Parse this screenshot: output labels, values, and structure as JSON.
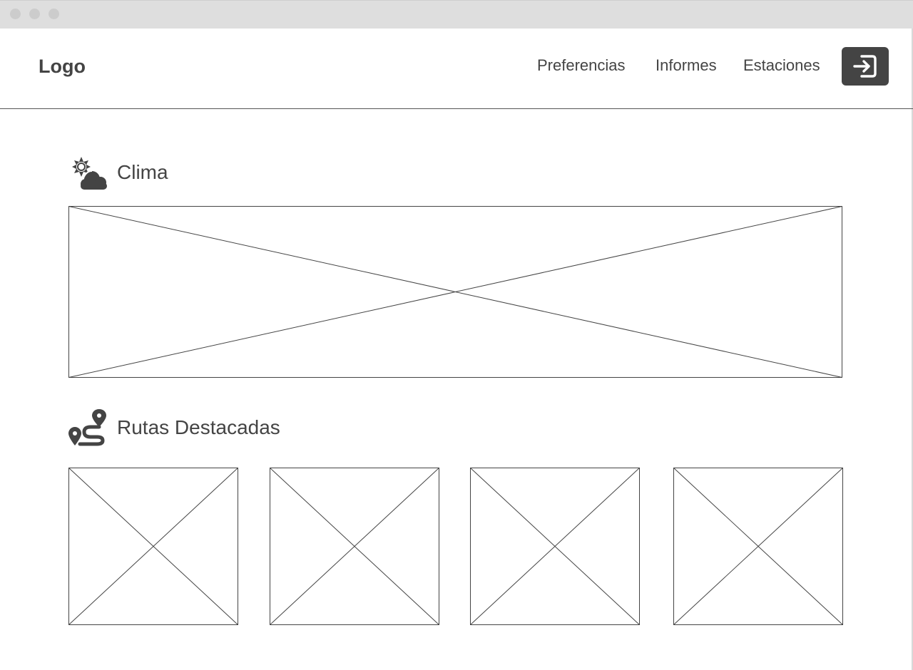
{
  "window": {
    "controls": [
      "close",
      "minimize",
      "maximize"
    ]
  },
  "header": {
    "logo": "Logo",
    "nav": [
      {
        "label": "Preferencias"
      },
      {
        "label": "Informes"
      },
      {
        "label": "Estaciones"
      }
    ],
    "logout_icon": "sign-out-icon"
  },
  "sections": {
    "clima": {
      "title": "Clima",
      "icon": "cloud-sun-icon"
    },
    "rutas": {
      "title": "Rutas Destacadas",
      "icon": "route-icon",
      "items_count": 4
    }
  },
  "colors": {
    "accent_dark": "#444444",
    "titlebar": "#dedede",
    "window_dots": "#cccccc",
    "line": "#444444"
  }
}
